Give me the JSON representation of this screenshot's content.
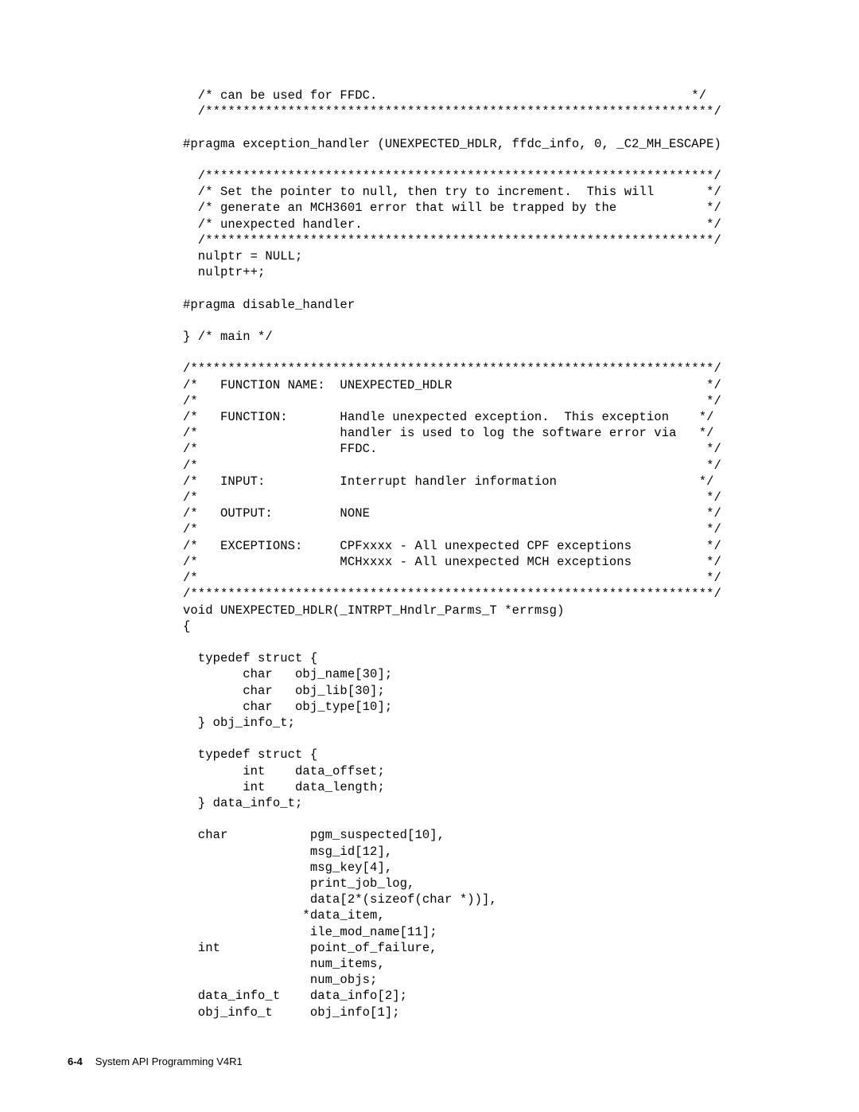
{
  "code": "  /* can be used for FFDC.                                          */\n  /********************************************************************/\n\n#pragma exception_handler (UNEXPECTED_HDLR, ffdc_info, 0, _C2_MH_ESCAPE)\n\n  /********************************************************************/\n  /* Set the pointer to null, then try to increment.  This will       */\n  /* generate an MCH3601 error that will be trapped by the            */\n  /* unexpected handler.                                              */\n  /********************************************************************/\n  nulptr = NULL;\n  nulptr++;\n\n#pragma disable_handler\n\n} /* main */\n\n/**********************************************************************/\n/*   FUNCTION NAME:  UNEXPECTED_HDLR                                  */\n/*                                                                    */\n/*   FUNCTION:       Handle unexpected exception.  This exception    */\n/*                   handler is used to log the software error via   */\n/*                   FFDC.                                            */\n/*                                                                    */\n/*   INPUT:          Interrupt handler information                   */\n/*                                                                    */\n/*   OUTPUT:         NONE                                             */\n/*                                                                    */\n/*   EXCEPTIONS:     CPFxxxx - All unexpected CPF exceptions          */\n/*                   MCHxxxx - All unexpected MCH exceptions          */\n/*                                                                    */\n/**********************************************************************/\nvoid UNEXPECTED_HDLR(_INTRPT_Hndlr_Parms_T *errmsg)\n{\n\n  typedef struct {\n        char   obj_name[30];\n        char   obj_lib[30];\n        char   obj_type[10];\n  } obj_info_t;\n\n  typedef struct {\n        int    data_offset;\n        int    data_length;\n  } data_info_t;\n\n  char           pgm_suspected[10],\n                 msg_id[12],\n                 msg_key[4],\n                 print_job_log,\n                 data[2*(sizeof(char *))],\n                *data_item,\n                 ile_mod_name[11];\n  int            point_of_failure,\n                 num_items,\n                 num_objs;\n  data_info_t    data_info[2];\n  obj_info_t     obj_info[1];",
  "footer": {
    "pagenum": "6-4",
    "title": "System API Programming V4R1"
  }
}
